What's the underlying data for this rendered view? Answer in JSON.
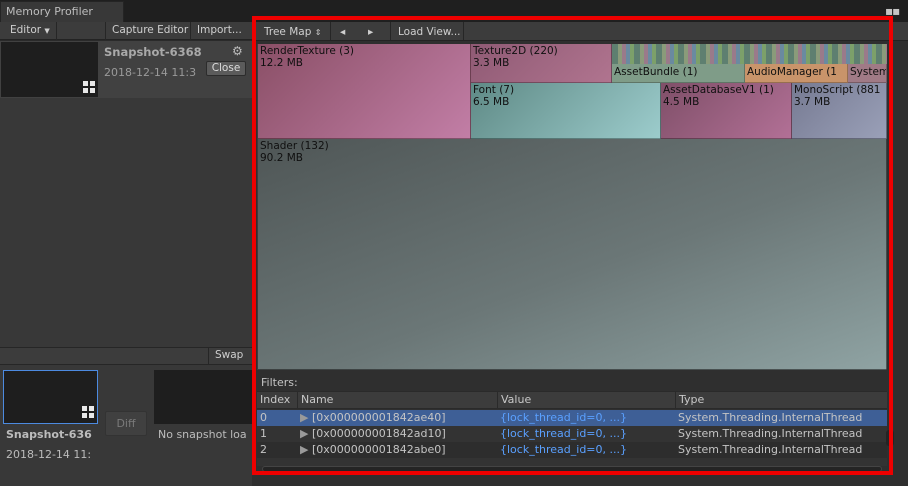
{
  "window": {
    "tab_title": "Memory Profiler"
  },
  "left_toolbar": {
    "editor_dropdown": "Editor",
    "capture_editor": "Capture Editor",
    "import": "Import..."
  },
  "snapshot_top": {
    "name": "Snapshot-6368",
    "date": "2018-12-14 11:3",
    "close": "Close"
  },
  "compare": {
    "swap": "Swap",
    "name": "Snapshot-636",
    "date": "2018-12-14 11:",
    "diff": "Diff",
    "empty": "No snapshot loa"
  },
  "right_toolbar": {
    "view_dropdown": "Tree Map",
    "load_view": "Load View..."
  },
  "treemap": [
    {
      "label": "RenderTexture (3)",
      "size": "12.2 MB"
    },
    {
      "label": "Texture2D (220)",
      "size": "3.3 MB"
    },
    {
      "label": "AssetBundle (1)",
      "size": ""
    },
    {
      "label": "AudioManager (1",
      "size": ""
    },
    {
      "label": "System",
      "size": ""
    },
    {
      "label": "Font (7)",
      "size": "6.5 MB"
    },
    {
      "label": "AssetDatabaseV1 (1)",
      "size": "4.5 MB"
    },
    {
      "label": "MonoScript (881",
      "size": "3.7 MB"
    },
    {
      "label": "Shader (132)",
      "size": "90.2 MB"
    }
  ],
  "filters_label": "Filters:",
  "table": {
    "columns": [
      "Index",
      "Name",
      "Value",
      "Type"
    ],
    "rows": [
      {
        "index": "0",
        "name": "[0x000000001842ae40]",
        "value": "{lock_thread_id=0, ...}",
        "type": "System.Threading.InternalThread"
      },
      {
        "index": "1",
        "name": "[0x000000001842ad10]",
        "value": "{lock_thread_id=0, ...}",
        "type": "System.Threading.InternalThread"
      },
      {
        "index": "2",
        "name": "[0x000000001842abe0]",
        "value": "{lock_thread_id=0, ...}",
        "type": "System.Threading.InternalThread"
      }
    ]
  },
  "colors": {
    "highlight": "#ee0000",
    "selected_row": "#3e5f96",
    "link": "#5aa0ff"
  }
}
